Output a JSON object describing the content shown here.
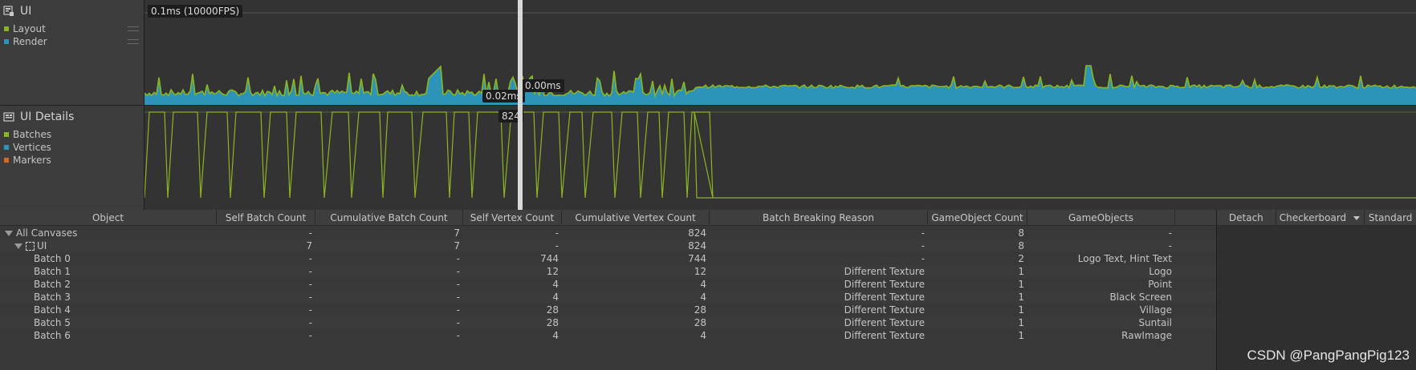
{
  "colors": {
    "layout": "#8db51f",
    "render": "#2b94b8",
    "batches": "#8db51f",
    "vertices": "#2b94b8",
    "markers": "#d2691e"
  },
  "modules": {
    "ui": {
      "title": "UI",
      "icon": "ui-module-icon",
      "legend": [
        {
          "label": "Layout"
        },
        {
          "label": "Render"
        }
      ]
    },
    "details": {
      "title": "UI Details",
      "icon": "ui-details-module-icon",
      "legend": [
        {
          "label": "Batches"
        },
        {
          "label": "Vertices"
        },
        {
          "label": "Markers"
        }
      ]
    }
  },
  "graph": {
    "top_label": "0.1ms (10000FPS)",
    "layout_value": "0.02ms",
    "render_value": "0.00ms",
    "details_value": "824"
  },
  "table": {
    "columns": [
      "Object",
      "Self Batch Count",
      "Cumulative Batch Count",
      "Self Vertex Count",
      "Cumulative Vertex Count",
      "Batch Breaking Reason",
      "GameObject Count",
      "GameObjects"
    ],
    "rows": [
      {
        "name": "All Canvases",
        "self_batch": "-",
        "cum_batch": "7",
        "self_vertex": "-",
        "cum_vertex": "824",
        "reason": "-",
        "go_count": "8",
        "gos": "-"
      },
      {
        "name": "UI",
        "self_batch": "7",
        "cum_batch": "7",
        "self_vertex": "-",
        "cum_vertex": "824",
        "reason": "-",
        "go_count": "8",
        "gos": "-"
      },
      {
        "name": "Batch 0",
        "self_batch": "-",
        "cum_batch": "-",
        "self_vertex": "744",
        "cum_vertex": "744",
        "reason": "-",
        "go_count": "2",
        "gos": "Logo Text, Hint Text"
      },
      {
        "name": "Batch 1",
        "self_batch": "-",
        "cum_batch": "-",
        "self_vertex": "12",
        "cum_vertex": "12",
        "reason": "Different Texture",
        "go_count": "1",
        "gos": "Logo"
      },
      {
        "name": "Batch 2",
        "self_batch": "-",
        "cum_batch": "-",
        "self_vertex": "4",
        "cum_vertex": "4",
        "reason": "Different Texture",
        "go_count": "1",
        "gos": "Point"
      },
      {
        "name": "Batch 3",
        "self_batch": "-",
        "cum_batch": "-",
        "self_vertex": "4",
        "cum_vertex": "4",
        "reason": "Different Texture",
        "go_count": "1",
        "gos": "Black Screen"
      },
      {
        "name": "Batch 4",
        "self_batch": "-",
        "cum_batch": "-",
        "self_vertex": "28",
        "cum_vertex": "28",
        "reason": "Different Texture",
        "go_count": "1",
        "gos": "Village"
      },
      {
        "name": "Batch 5",
        "self_batch": "-",
        "cum_batch": "-",
        "self_vertex": "28",
        "cum_vertex": "28",
        "reason": "Different Texture",
        "go_count": "1",
        "gos": "Suntail"
      },
      {
        "name": "Batch 6",
        "self_batch": "-",
        "cum_batch": "-",
        "self_vertex": "4",
        "cum_vertex": "4",
        "reason": "Different Texture",
        "go_count": "1",
        "gos": "RawImage"
      }
    ]
  },
  "side": {
    "detach": "Detach",
    "background_select": "Checkerboard",
    "mode": "Standard"
  },
  "watermark": "CSDN @PangPangPig123"
}
